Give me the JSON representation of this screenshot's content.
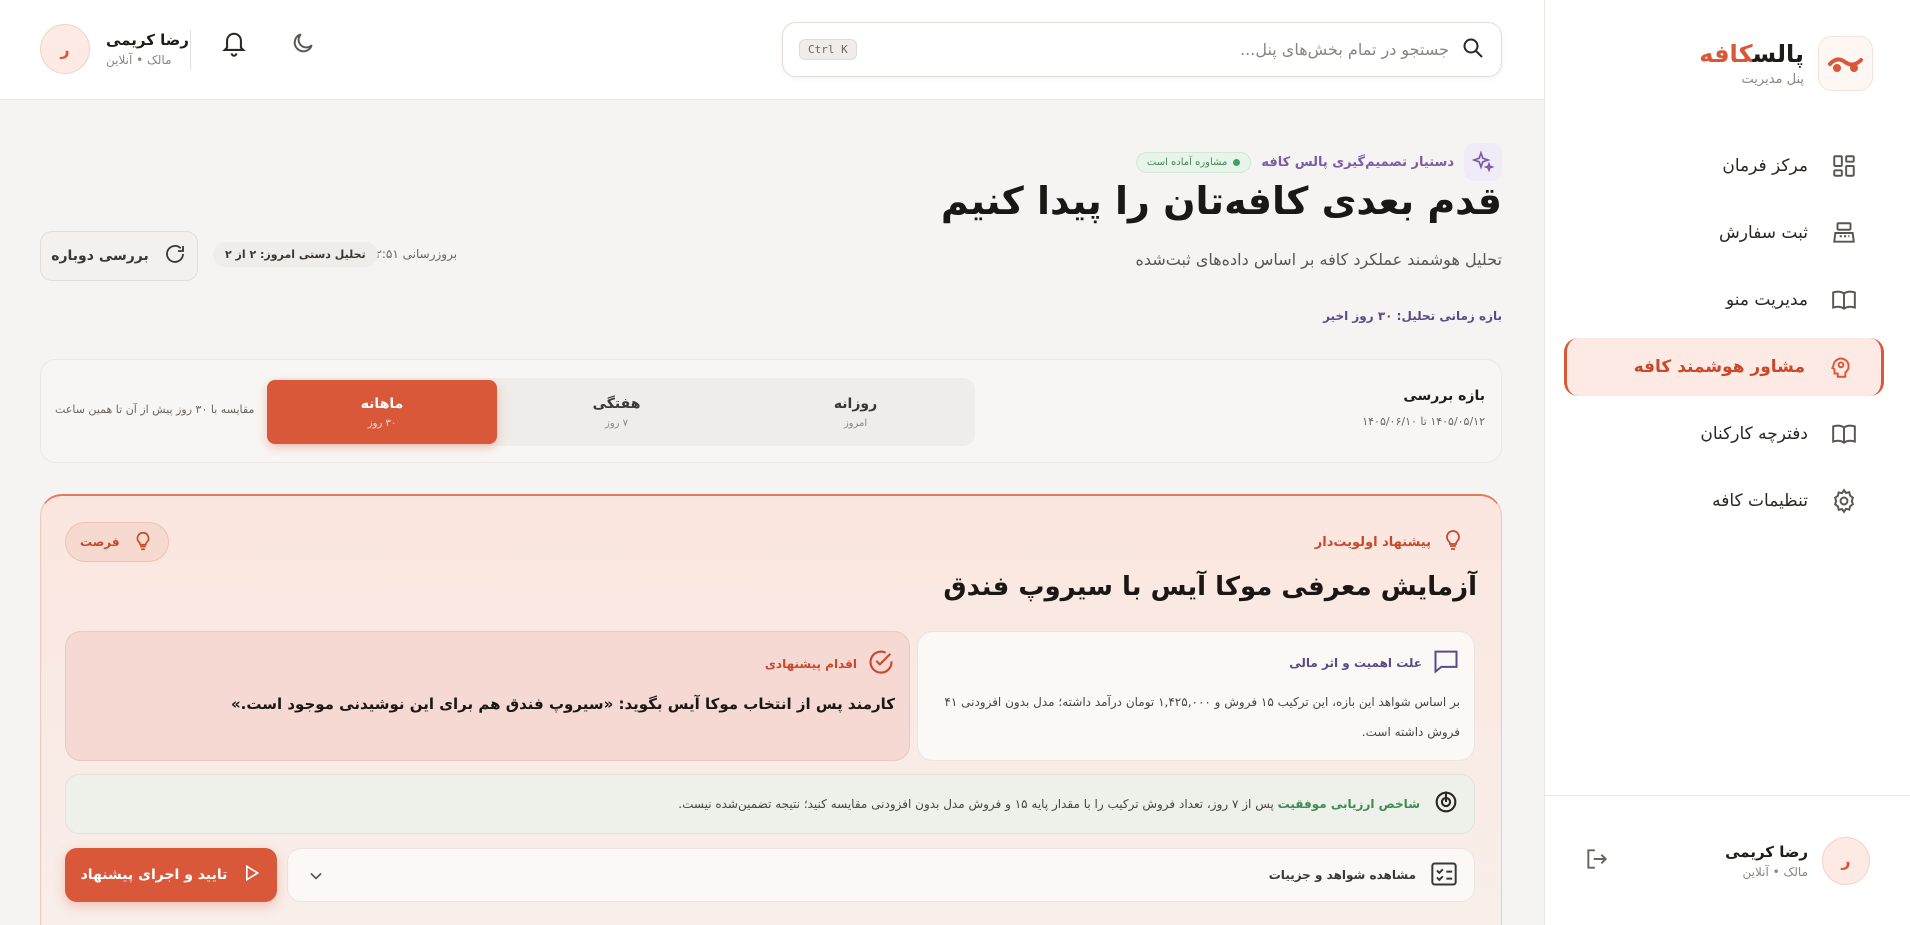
{
  "brand": {
    "name_main": "پالس",
    "name_accent": "کافه",
    "subtitle": "پنل مدیریت"
  },
  "sidebar": {
    "items": [
      {
        "label": "مرکز فرمان",
        "icon": "grid-icon",
        "active": false
      },
      {
        "label": "ثبت سفارش",
        "icon": "cash-register-icon",
        "active": false
      },
      {
        "label": "مدیریت منو",
        "icon": "book-icon",
        "active": false
      },
      {
        "label": "مشاور هوشمند کافه",
        "icon": "brain-icon",
        "active": true
      },
      {
        "label": "دفترچه کارکنان",
        "icon": "book-icon",
        "active": false
      },
      {
        "label": "تنظیمات کافه",
        "icon": "gear-icon",
        "active": false
      }
    ],
    "user": {
      "initial": "ر",
      "name": "رضا کریمی",
      "role": "مالک • آنلاین"
    }
  },
  "header": {
    "search_placeholder": "جستجو در تمام بخش‌های پنل...",
    "shortcut": "Ctrl K",
    "user": {
      "initial": "ر",
      "name": "رضا کریمی",
      "role": "مالک • آنلاین"
    }
  },
  "main": {
    "assistant_label": "دستیار تصمیم‌گیری پالس کافه",
    "status_pill": "مشاوره آماده است",
    "title": "قدم بعدی کافه‌تان را پیدا کنیم",
    "subtitle": "تحلیل هوشمند عملکرد کافه بر اساس داده‌های ثبت‌شده",
    "range_label": "بازه زمانی تحلیل: ۳۰ روز اخیر",
    "refresh_label": "بررسی دوباره",
    "manual_pill": "تحلیل دستی امروز: ۲ از ۲",
    "updated": "بروزرسانی ۱۲:۵۱",
    "period": {
      "title": "بازه بررسی",
      "dates": "۱۴۰۵/۰۵/۱۲ تا ۱۴۰۵/۰۶/۱۰",
      "tabs": [
        {
          "label": "روزانه",
          "sub": "امروز",
          "active": false
        },
        {
          "label": "هفتگی",
          "sub": "۷ روز",
          "active": false
        },
        {
          "label": "ماهانه",
          "sub": "۳۰ روز",
          "active": true
        }
      ],
      "compare_note": "مقایسه با ۳۰ روز پیش از آن تا همین ساعت"
    },
    "recommendation": {
      "priority_label": "پیشنهاد اولویت‌دار",
      "tag": "فرصت",
      "title": "آزمایش معرفی موکا آیس با سیروپ فندق",
      "why_title": "علت اهمیت و اثر مالی",
      "why_text": "بر اساس شواهد این بازه، این ترکیب ۱۵ فروش و ۱,۴۲۵,۰۰۰ تومان درآمد داشته؛ مدل بدون افزودنی ۴۱ فروش داشته است.",
      "action_title": "اقدام پیشنهادی",
      "action_text": "کارمند پس از انتخاب موکا آیس بگوید: «سیروپ فندق هم برای این نوشیدنی موجود است.»",
      "kpi_label": "شاخص ارزیابی موفقیت",
      "kpi_text": "پس از ۷ روز، تعداد فروش ترکیب را با مقدار پایه ۱۵ و فروش مدل بدون افزودنی مقایسه کنید؛ نتیجه تضمین‌شده نیست.",
      "details_label": "مشاهده شواهد و جزییات",
      "approve_label": "تایید و اجرای پیشنهاد"
    }
  },
  "colors": {
    "accent": "#d9583a",
    "purple": "#7a5ca8",
    "green": "#3f8a55"
  }
}
